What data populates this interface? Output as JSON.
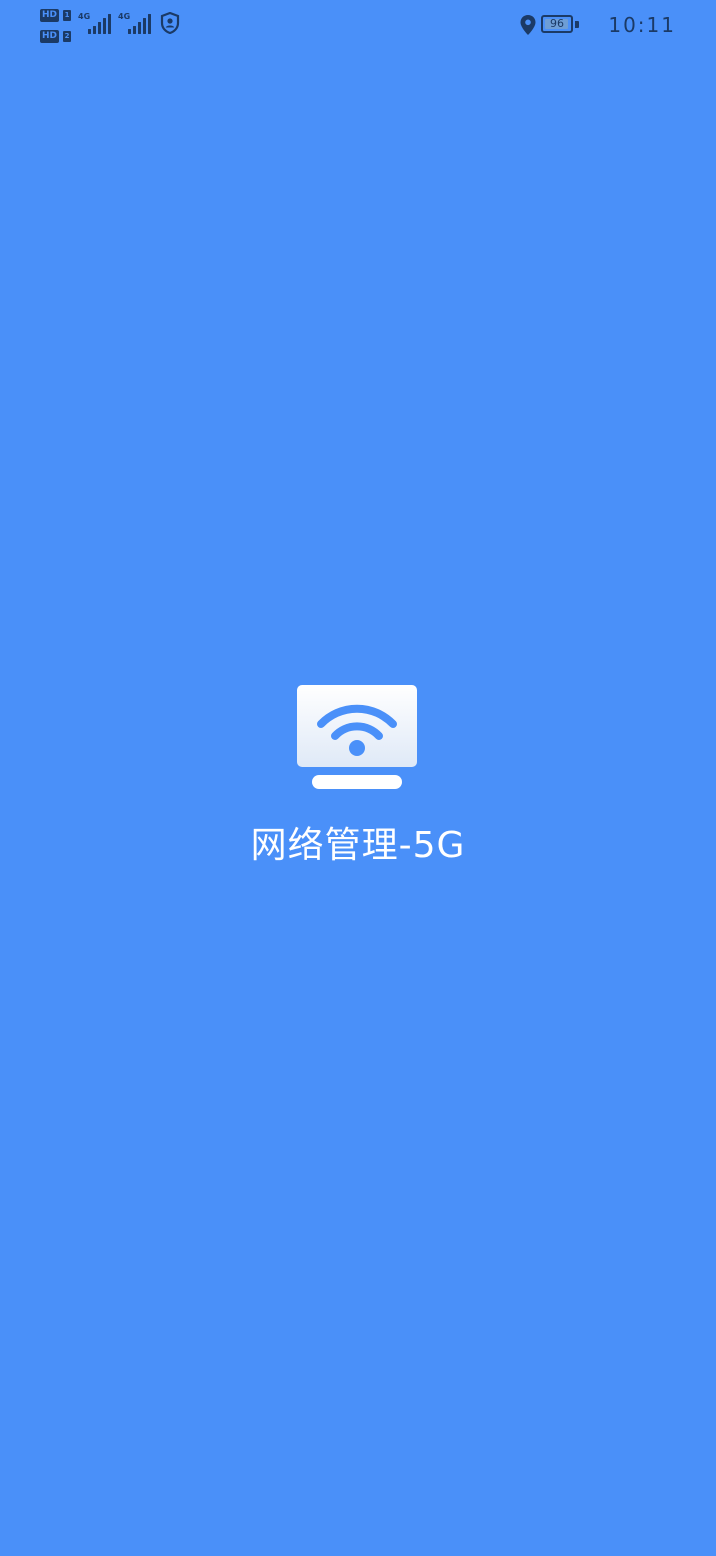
{
  "colors": {
    "background": "#4a90f9",
    "status_icons": "#1b3a66",
    "title_text": "#ffffff"
  },
  "status_bar": {
    "hd_badge_1": "HD",
    "hd_badge_2": "HD",
    "sim_1": "1",
    "sim_2": "2",
    "network_1": "4G",
    "network_2": "4G",
    "battery_level": "96",
    "battery_fraction": 0.96,
    "time": "10:11",
    "icons": [
      "hd-volte-icon",
      "signal-strength-icon",
      "security-shield-icon",
      "location-pin-icon",
      "battery-icon"
    ]
  },
  "splash": {
    "logo_icon": "monitor-wifi-icon",
    "app_name": "网络管理-5G"
  }
}
